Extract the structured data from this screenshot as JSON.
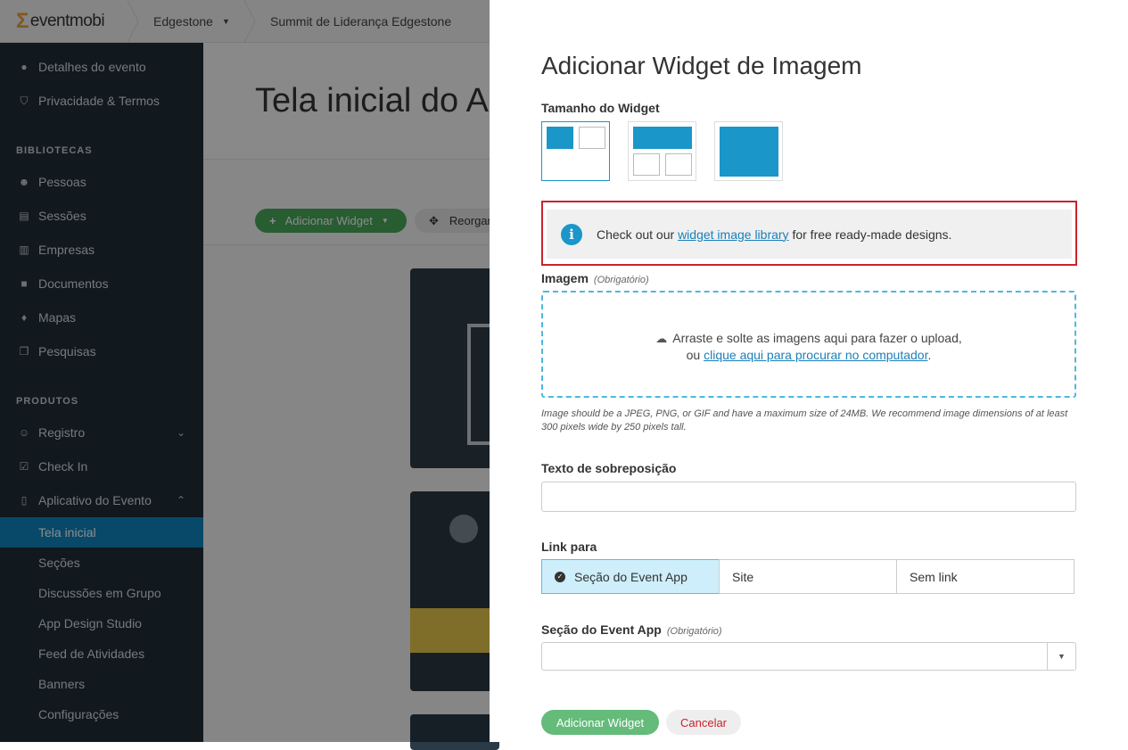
{
  "topbar": {
    "logo_text": "eventmobi",
    "org": "Edgestone",
    "event": "Summit de Liderança Edgestone"
  },
  "sidebar": {
    "top_items": [
      {
        "label": "Detalhes do evento",
        "icon": "info-icon"
      },
      {
        "label": "Privacidade & Termos",
        "icon": "shield-icon"
      }
    ],
    "sections": {
      "libraries": "BIBLIOTECAS",
      "products": "PRODUTOS"
    },
    "library_items": [
      {
        "label": "Pessoas",
        "icon": "people-icon"
      },
      {
        "label": "Sessões",
        "icon": "calendar-icon"
      },
      {
        "label": "Empresas",
        "icon": "building-icon"
      },
      {
        "label": "Documentos",
        "icon": "briefcase-icon"
      },
      {
        "label": "Mapas",
        "icon": "map-pin-icon"
      },
      {
        "label": "Pesquisas",
        "icon": "survey-icon"
      }
    ],
    "product_items": [
      {
        "label": "Registro",
        "icon": "user-plus-icon"
      },
      {
        "label": "Check In",
        "icon": "checkbox-icon"
      },
      {
        "label": "Aplicativo do Evento",
        "icon": "mobile-icon"
      }
    ],
    "app_sub_items": [
      "Tela inicial",
      "Seções",
      "Discussões em Grupo",
      "App Design Studio",
      "Feed de Atividades",
      "Banners",
      "Configurações"
    ]
  },
  "main": {
    "title": "Tela inicial do A",
    "add_widget": "Adicionar Widget",
    "reorder": "Reorgar"
  },
  "panel": {
    "title": "Adicionar Widget de Imagem",
    "widget_size_label": "Tamanho do Widget",
    "callout": {
      "prefix": "Check out our ",
      "link": "widget image library",
      "suffix": " for free ready-made designs."
    },
    "image_label": "Imagem",
    "required": "(Obrigatório)",
    "dropzone": {
      "line1": "Arraste e solte as imagens aqui para fazer o upload,",
      "line2_prefix": "ou ",
      "line2_link": "clique aqui para procurar no computador",
      "line2_suffix": "."
    },
    "image_hint": "Image should be a JPEG, PNG, or GIF and have a maximum size of 24MB. We recommend image dimensions of at least 300 pixels wide by 250 pixels tall.",
    "overlay_text_label": "Texto de sobreposição",
    "overlay_text_value": "",
    "link_label": "Link para",
    "link_options": [
      "Seção do Event App",
      "Site",
      "Sem link"
    ],
    "section_label": "Seção do Event App",
    "section_value": "",
    "submit": "Adicionar Widget",
    "cancel": "Cancelar"
  },
  "colors": {
    "accent": "#1a96c9",
    "sidebar_bg": "#1f2d38",
    "active_item": "#0f86c0",
    "success": "#64bb7a",
    "danger": "#c8232c"
  }
}
